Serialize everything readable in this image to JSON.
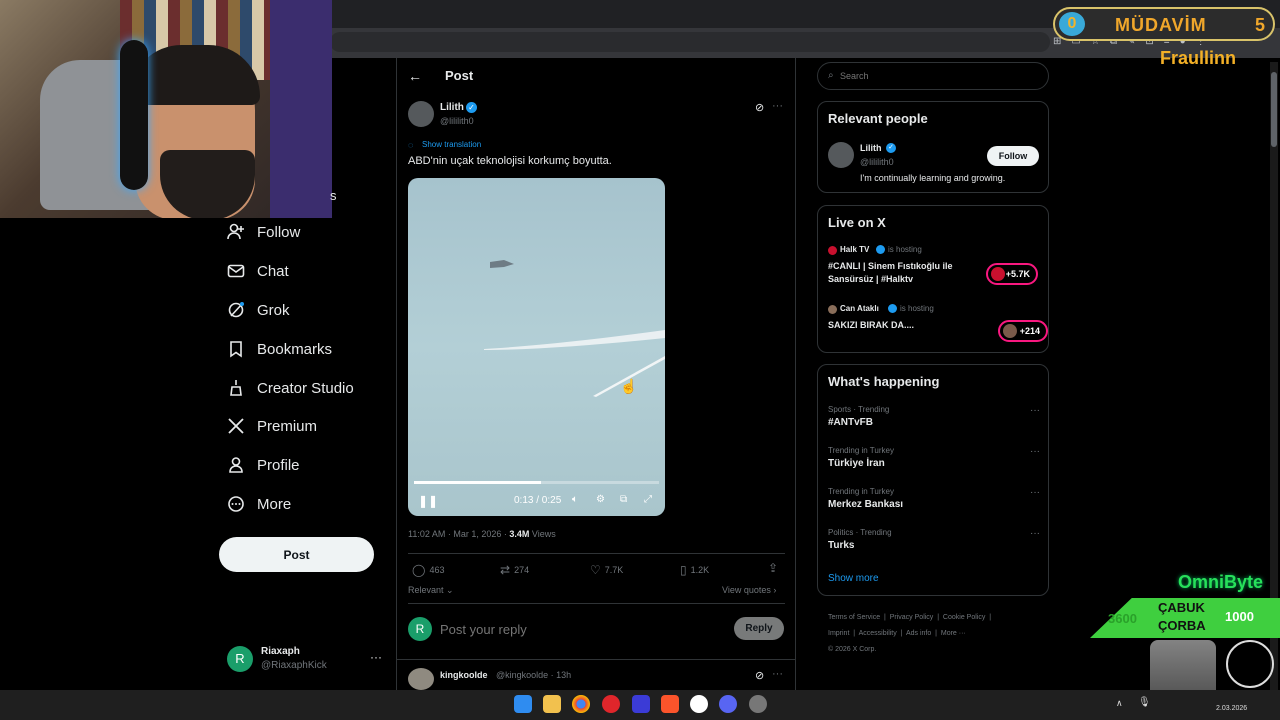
{
  "overlay": {
    "mudavim_label": "MÜDAVİM",
    "mudavim_left": "0",
    "mudavim_count": "5",
    "streamer_name": "Fraullinn",
    "omni_label": "OmniByte",
    "cabuk_label": "ÇABUK",
    "corba_label": "ÇORBA",
    "cabuk_left_value": "3600",
    "cabuk_right_value": "1000"
  },
  "nav": {
    "partial_item": "s",
    "items": [
      {
        "label": "Follow",
        "icon": "follow-icon"
      },
      {
        "label": "Chat",
        "icon": "mail-icon"
      },
      {
        "label": "Grok",
        "icon": "grok-icon"
      },
      {
        "label": "Bookmarks",
        "icon": "bookmark-icon"
      },
      {
        "label": "Creator Studio",
        "icon": "creator-studio-icon"
      },
      {
        "label": "Premium",
        "icon": "x-logo-icon"
      },
      {
        "label": "Profile",
        "icon": "profile-icon"
      },
      {
        "label": "More",
        "icon": "more-circle-icon"
      }
    ],
    "post_button": "Post",
    "account": {
      "avatar_letter": "R",
      "name": "Riaxaph",
      "handle": "@RiaxaphKick"
    }
  },
  "post": {
    "header_title": "Post",
    "author_name": "Lilith",
    "author_handle": "@lililith0",
    "show_translation": "Show translation",
    "text": "ABD'nin uçak teknolojisi korkumç boyutta.",
    "video": {
      "time": "0:13 / 0:25",
      "progress_fraction": 0.52
    },
    "timestamp": "11:02 AM · Mar 1, 2026 · ",
    "views_count": "3.4M",
    "views_label": " Views",
    "stats": {
      "replies": "463",
      "reposts": "274",
      "likes": "7.7K",
      "bookmarks": "1.2K"
    },
    "sort_label": "Relevant",
    "view_quotes": "View quotes",
    "reply_placeholder": "Post your reply",
    "reply_avatar_letter": "R",
    "reply_button": "Reply"
  },
  "reply_item": {
    "name": "kingkoolde",
    "handle": "@kingkoolde · 13h"
  },
  "right": {
    "search_placeholder": "Search",
    "relevant_people": {
      "title": "Relevant people",
      "name": "Lilith",
      "handle": "@lililith0",
      "follow": "Follow",
      "bio": "I'm continually learning and growing."
    },
    "live": {
      "title": "Live on X",
      "items": [
        {
          "host": "Halk TV",
          "hosting": "is hosting",
          "title_line1": "#CANLI | Sinem Fıstıkoğlu ile",
          "title_line2": "Sansürsüz | #Halktv",
          "count": "+5.7K"
        },
        {
          "host": "Can Ataklı",
          "hosting": "is hosting",
          "title_line1": "SAKIZI BIRAK DA....",
          "title_line2": "",
          "count": "+214"
        }
      ]
    },
    "happening": {
      "title": "What's happening",
      "items": [
        {
          "context": "Sports · Trending",
          "topic": "#ANTvFB"
        },
        {
          "context": "Trending in Turkey",
          "topic": "Türkiye İran"
        },
        {
          "context": "Trending in Turkey",
          "topic": "Merkez Bankası"
        },
        {
          "context": "Politics · Trending",
          "topic": "Turks"
        }
      ],
      "show_more": "Show more"
    },
    "footer": {
      "links_row1": [
        "Terms of Service",
        "Privacy Policy",
        "Cookie Policy"
      ],
      "links_row2": [
        "Imprint",
        "Accessibility",
        "Ads info",
        "More ···"
      ],
      "copyright": "© 2026 X Corp."
    }
  },
  "taskbar": {
    "date": "2.03.2026"
  },
  "colors": {
    "accent": "#1d9bf0",
    "live": "#f91880",
    "verified": "#1d9bf0"
  }
}
